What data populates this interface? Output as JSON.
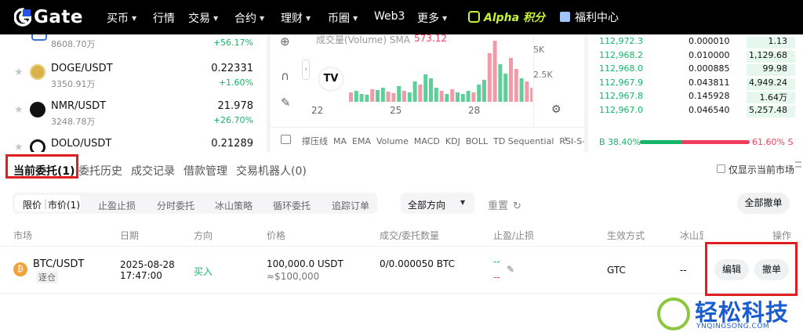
{
  "nav": {
    "logo": "Gate",
    "items": [
      "买币",
      "行情",
      "交易",
      "合约",
      "理财",
      "币圈",
      "Web3",
      "更多"
    ],
    "alpha": "Alpha 积分",
    "welfare": "福利中心"
  },
  "markets": [
    {
      "pair": "",
      "vol": "8608.70万",
      "price": "",
      "change": "+56.17%"
    },
    {
      "pair": "DOGE/USDT",
      "vol": "3350.91万",
      "price": "0.22331",
      "change": "+1.60%"
    },
    {
      "pair": "NMR/USDT",
      "vol": "3248.78万",
      "price": "21.978",
      "change": "+26.70%"
    },
    {
      "pair": "DOLO/USDT",
      "vol": "",
      "price": "0.21289",
      "change": ""
    }
  ],
  "chart": {
    "volume_label": "成交量(Volume) SMA",
    "sma_value": "573.12",
    "y_ticks": [
      "5K",
      "2.5K"
    ],
    "x_ticks": [
      "22",
      "25",
      "28"
    ],
    "indicators": [
      "撑压线",
      "MA",
      "EMA",
      "Volume",
      "MACD",
      "KDJ",
      "BOLL",
      "TD Sequential",
      "RSI-S-I"
    ],
    "bars_up": [
      0,
      1,
      1,
      1,
      0,
      1,
      1,
      0,
      0,
      1,
      0,
      1,
      1,
      0,
      1,
      1,
      1,
      0,
      1,
      0,
      1,
      1,
      1,
      0,
      1,
      1,
      0,
      0,
      1,
      1,
      0,
      0,
      1,
      0,
      0,
      1,
      0,
      1,
      1,
      0
    ],
    "bars_h": [
      12,
      14,
      10,
      9,
      16,
      15,
      18,
      13,
      11,
      20,
      14,
      12,
      26,
      22,
      35,
      30,
      18,
      14,
      10,
      16,
      12,
      10,
      14,
      12,
      22,
      28,
      62,
      78,
      48,
      36,
      56,
      42,
      30,
      26,
      18,
      14,
      10,
      38,
      24,
      18
    ]
  },
  "orderbook": {
    "rows": [
      {
        "price": "112,972.3",
        "amount": "0.000010",
        "total": "1.13",
        "depth": 0.62
      },
      {
        "price": "112,968.2",
        "amount": "0.010000",
        "total": "1,129.68",
        "depth": 0.62
      },
      {
        "price": "112,968.0",
        "amount": "0.000885",
        "total": "99.98",
        "depth": 0.62
      },
      {
        "price": "112,967.9",
        "amount": "0.043811",
        "total": "4,949.24",
        "depth": 0.62
      },
      {
        "price": "112,967.8",
        "amount": "0.145928",
        "total": "1.64万",
        "depth": 0.62
      },
      {
        "price": "112,967.0",
        "amount": "0.046540",
        "total": "5,257.48",
        "depth": 0.62
      }
    ],
    "buy_ratio": "B 38.40%",
    "sell_ratio": "61.60% S",
    "buy_pct": 38.4
  },
  "tabs": [
    {
      "label": "当前委托(1)",
      "active": true
    },
    {
      "label": "委托历史"
    },
    {
      "label": "成交记录"
    },
    {
      "label": "借款管理"
    },
    {
      "label": "交易机器人(0)"
    }
  ],
  "only_current": "仅显示当前市场",
  "filters": {
    "limit": "限价",
    "market": "市价(1)",
    "items": [
      "止盈止损",
      "分时委托",
      "冰山策略",
      "循环委托",
      "追踪订单"
    ],
    "direction": "全部方向",
    "reset": "重置",
    "cancel_all": "全部撤单"
  },
  "table": {
    "headers": [
      "市场",
      "日期",
      "方向",
      "价格",
      "成交/委托数量",
      "止盈/止损",
      "生效方式",
      "冰山显",
      "操作"
    ],
    "row": {
      "pair": "BTC/USDT",
      "tag": "逐仓",
      "date": "2025-08-28",
      "time": "17:47:00",
      "side": "买入",
      "price": "100,000.0 USDT",
      "price_sub": "≈$100,000",
      "qty": "0/0.000050 BTC",
      "tp": "--",
      "sl": "--",
      "tif": "GTC",
      "iceberg": "--",
      "edit": "编辑",
      "cancel": "撤单"
    }
  },
  "watermark": {
    "title": "轻松科技",
    "url": "YNQINGSONG.COM"
  },
  "colors": {
    "up": "#14b66a",
    "down": "#f03e5c",
    "highlight": "#e02020"
  }
}
